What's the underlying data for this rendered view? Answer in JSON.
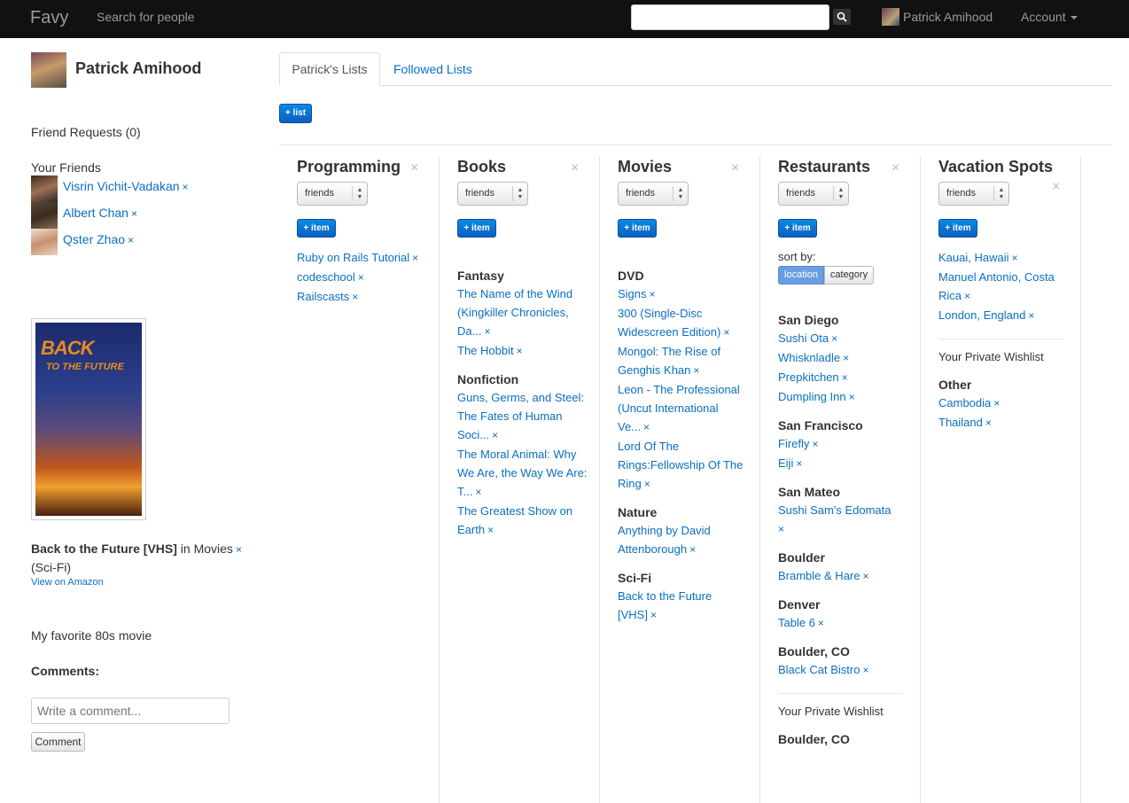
{
  "navbar": {
    "brand": "Favy",
    "search_link": "Search for people",
    "search_input_value": "",
    "user_name": "Patrick Amihood",
    "account_label": "Account"
  },
  "sidebar": {
    "profile_name": "Patrick Amihood",
    "friend_requests": "Friend Requests (0)",
    "your_friends": "Your Friends",
    "friends": [
      {
        "name": "Visrin Vichit-Vadakan"
      },
      {
        "name": "Albert Chan"
      },
      {
        "name": "Qster Zhao"
      }
    ],
    "remove_mark": "×",
    "recommendation": {
      "title": "Back to the Future [VHS]",
      "in_text": "in Movies",
      "subcategory": "(Sci-Fi)",
      "view_link": "View on Amazon",
      "note": "My favorite 80s movie",
      "poster_text_1": "BACK",
      "poster_text_2": "TO THE FUTURE"
    },
    "comments_heading": "Comments:",
    "comment_placeholder": "Write a comment...",
    "comment_button": "Comment"
  },
  "tabs": {
    "active": "Patrick's Lists",
    "other": "Followed Lists"
  },
  "add_list_button": "+ list",
  "add_item_label": "+ item",
  "close_mark": "×",
  "lists": [
    {
      "title": "Programming",
      "privacy": "friends",
      "groups": [
        {
          "heading": "",
          "items": [
            "Ruby on Rails Tutorial",
            "codeschool",
            "Railscasts"
          ]
        }
      ]
    },
    {
      "title": "Books",
      "privacy": "friends",
      "groups": [
        {
          "heading": "Fantasy",
          "items": [
            "The Name of the Wind (Kingkiller Chronicles, Da...",
            "The Hobbit"
          ]
        },
        {
          "heading": "Nonfiction",
          "items": [
            "Guns, Germs, and Steel: The Fates of Human Soci...",
            "The Moral Animal: Why We Are, the Way We Are: T...",
            "The Greatest Show on Earth"
          ]
        }
      ]
    },
    {
      "title": "Movies",
      "privacy": "friends",
      "groups": [
        {
          "heading": "DVD",
          "items": [
            "Signs",
            "300 (Single-Disc Widescreen Edition)",
            "Mongol: The Rise of Genghis Khan",
            "Leon - The Professional (Uncut International Ve...",
            "Lord Of The Rings:Fellowship Of The Ring"
          ]
        },
        {
          "heading": "Nature",
          "items": [
            "Anything by David Attenborough"
          ]
        },
        {
          "heading": "Sci-Fi",
          "items": [
            "Back to the Future [VHS]"
          ]
        }
      ]
    },
    {
      "title": "Restaurants",
      "privacy": "friends",
      "sort_by_label": "sort by:",
      "sort_options": [
        "location",
        "category"
      ],
      "groups": [
        {
          "heading": "San Diego",
          "items": [
            "Sushi Ota",
            "Whisknladle",
            "Prepkitchen",
            "Dumpling Inn"
          ]
        },
        {
          "heading": "San Francisco",
          "items": [
            "Firefly",
            "Eiji"
          ]
        },
        {
          "heading": "San Mateo",
          "items": [
            "Sushi Sam's Edomata"
          ]
        },
        {
          "heading": "Boulder",
          "items": [
            "Bramble & Hare"
          ]
        },
        {
          "heading": "Denver",
          "items": [
            "Table 6"
          ]
        },
        {
          "heading": "Boulder, CO",
          "items": [
            "Black Cat Bistro"
          ]
        }
      ],
      "private_wishlist": "Your Private Wishlist",
      "private_groups": [
        {
          "heading": "Boulder, CO",
          "items": []
        }
      ]
    },
    {
      "title": "Vacation Spots",
      "privacy": "friends",
      "groups": [
        {
          "heading": "",
          "items": [
            "Kauai, Hawaii",
            "Manuel Antonio, Costa Rica",
            "London, England"
          ]
        }
      ],
      "private_wishlist": "Your Private Wishlist",
      "private_groups": [
        {
          "heading": "Other",
          "items": [
            "Cambodia",
            "Thailand"
          ]
        }
      ]
    }
  ],
  "colors": {
    "link": "#0a6fc2",
    "navbar": "#111111",
    "primary_button": "#0a6fc2"
  }
}
